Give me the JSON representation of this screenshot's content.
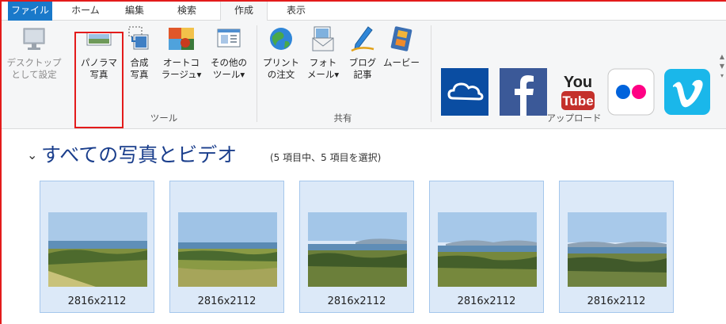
{
  "tabs": [
    {
      "label": "ファイル"
    },
    {
      "label": "ホーム"
    },
    {
      "label": "編集"
    },
    {
      "label": "検索"
    },
    {
      "label": "作成"
    },
    {
      "label": "表示"
    }
  ],
  "ribbon": {
    "tools": {
      "group_label": "ツール",
      "desktop_bg": {
        "line1": "デスクトップ",
        "line2": "として設定"
      },
      "panorama": {
        "line1": "パノラマ",
        "line2": "写真"
      },
      "composite": {
        "line1": "合成",
        "line2": "写真"
      },
      "autocollage": {
        "line1": "オートコ",
        "line2": "ラージュ▾"
      },
      "other_tools": {
        "line1": "その他の",
        "line2": "ツール▾"
      }
    },
    "share": {
      "group_label": "共有",
      "print_order": {
        "line1": "プリント",
        "line2": "の注文"
      },
      "photo_mail": {
        "line1": "フォト",
        "line2": "メール▾"
      },
      "blog_post": {
        "line1": "ブログ",
        "line2": "記事"
      },
      "movie": {
        "line1": "ムービー",
        "line2": ""
      }
    },
    "upload": {
      "group_label": "アップロード",
      "youtube_you": "You",
      "youtube_tube": "Tube"
    }
  },
  "content": {
    "title": "すべての写真とビデオ",
    "subtitle": "(5 項目中、5 項目を選択)",
    "photos": [
      {
        "dimensions": "2816x2112"
      },
      {
        "dimensions": "2816x2112"
      },
      {
        "dimensions": "2816x2112"
      },
      {
        "dimensions": "2816x2112"
      },
      {
        "dimensions": "2816x2112"
      }
    ]
  },
  "colors": {
    "file_tab": "#1979ca",
    "highlight_box": "#e31b1b",
    "selection_bg": "#dce9f8",
    "onedrive": "#0a4da2",
    "facebook": "#3b5998",
    "youtube": "#c4302b",
    "flickr_blue": "#0063dc",
    "flickr_pink": "#ff0084",
    "vimeo": "#1ab7ea"
  }
}
